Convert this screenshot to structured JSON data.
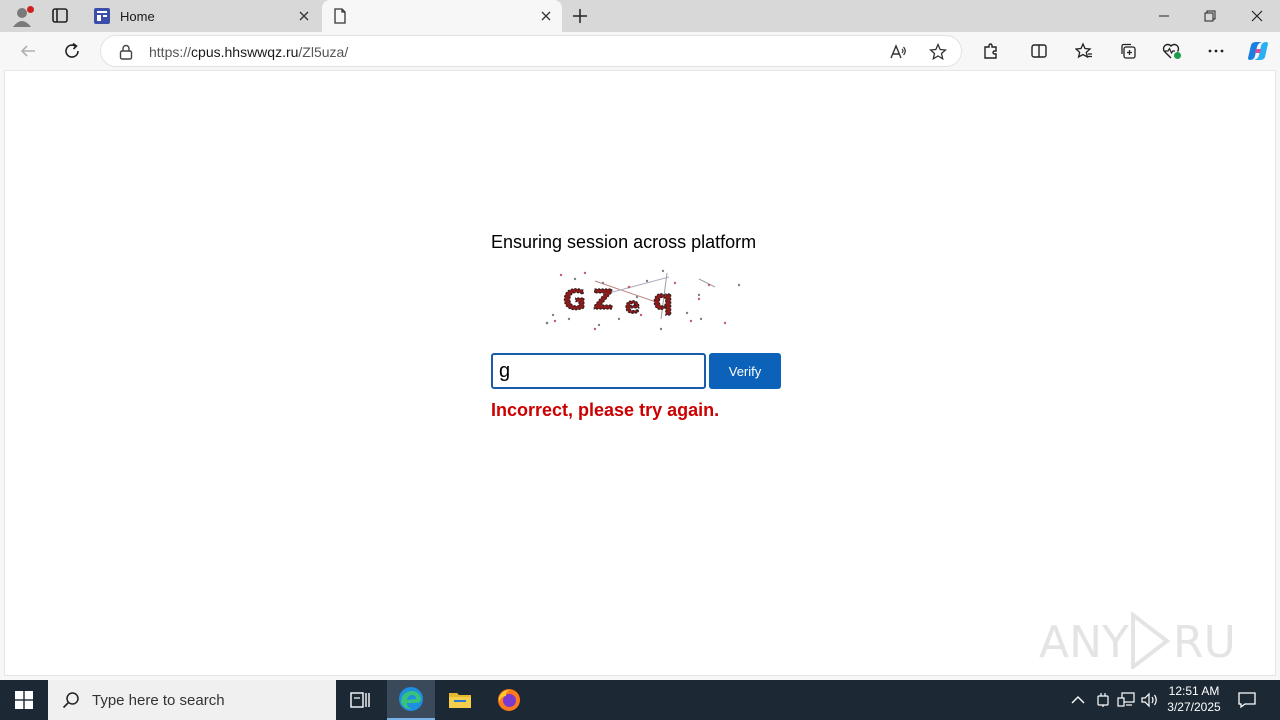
{
  "browser": {
    "tabs": [
      {
        "title": "Home",
        "active": false
      },
      {
        "title": "",
        "active": true
      }
    ],
    "url_scheme": "https://",
    "url_host": "cpus.hhswwqz.ru",
    "url_path": "/Zl5uza/"
  },
  "page": {
    "heading": "Ensuring session across platform",
    "captcha_text": [
      "G",
      "Z",
      "e",
      "q"
    ],
    "input_value": "g",
    "verify_label": "Verify",
    "error_message": "Incorrect, please try again.",
    "watermark": "ANY.RUN"
  },
  "taskbar": {
    "search_placeholder": "Type here to search",
    "time": "12:51 AM",
    "date": "3/27/2025"
  },
  "colors": {
    "accent": "#0b62b8",
    "error": "#cc0000",
    "captcha_letters": "#8b1a1a"
  }
}
